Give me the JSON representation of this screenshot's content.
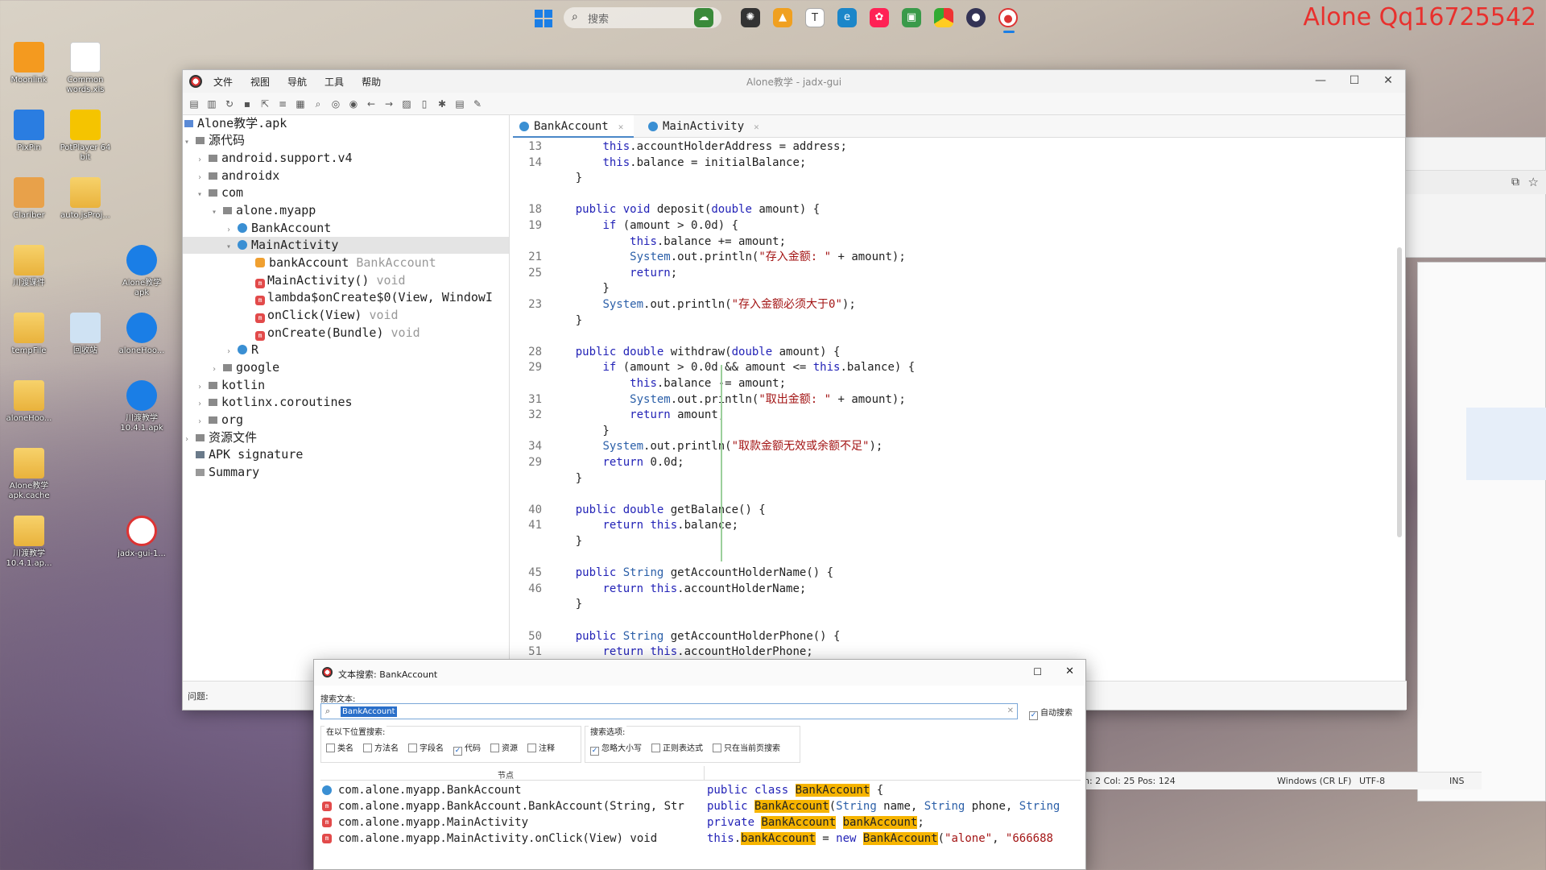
{
  "watermark": "Alone Qq16725542",
  "taskbar": {
    "search_placeholder": "搜索",
    "apps": [
      "weather-icon",
      "bug-icon",
      "firewall-icon",
      "typora-icon",
      "edge-icon",
      "paint-icon",
      "photos-icon",
      "chrome-icon",
      "mixed-app-icon",
      "jadx-taskbar-icon"
    ]
  },
  "desktop": {
    "icons": [
      {
        "label": "Moonlink",
        "kind": "app"
      },
      {
        "label": "Common words.xls",
        "kind": "file"
      },
      {
        "label": "PixPin",
        "kind": "app"
      },
      {
        "label": "PotPlayer 64 bit",
        "kind": "app"
      },
      {
        "label": "Clariber",
        "kind": "app"
      },
      {
        "label": "auto.jsProj...",
        "kind": "folder"
      },
      {
        "label": "川渡课件",
        "kind": "folder"
      },
      {
        "label": "Alone教学 apk",
        "kind": "app"
      },
      {
        "label": "tempFile",
        "kind": "folder"
      },
      {
        "label": "回收站",
        "kind": "app"
      },
      {
        "label": "aloneHoo...",
        "kind": "app"
      },
      {
        "label": "aloneHoo...",
        "kind": "folder"
      },
      {
        "label": "川渡教学 10.4.1.apk",
        "kind": "app"
      },
      {
        "label": "Alone教学 apk.cache",
        "kind": "folder"
      },
      {
        "label": "川渡教学 10.4.1.ap...",
        "kind": "folder"
      },
      {
        "label": "jadx-gui-1...",
        "kind": "app"
      }
    ]
  },
  "window": {
    "title": "Alone教学 - jadx-gui",
    "menu": [
      "文件",
      "视图",
      "导航",
      "工具",
      "帮助"
    ],
    "tree": [
      {
        "label": "Alone教学.apk",
        "icon": "apk",
        "level": 0
      },
      {
        "label": "源代码",
        "icon": "src",
        "level": 0,
        "arrow": "▾"
      },
      {
        "label": "android.support.v4",
        "icon": "pkg",
        "level": 1,
        "arrow": "›"
      },
      {
        "label": "androidx",
        "icon": "pkg",
        "level": 1,
        "arrow": "›"
      },
      {
        "label": "com",
        "icon": "pkg",
        "level": 1,
        "arrow": "▾"
      },
      {
        "label": "alone.myapp",
        "icon": "pkg",
        "level": 2,
        "arrow": "▾"
      },
      {
        "label": "BankAccount",
        "icon": "cls",
        "level": 3,
        "arrow": "›"
      },
      {
        "label": "MainActivity",
        "icon": "cls",
        "level": 3,
        "arrow": "▾",
        "selected": true
      },
      {
        "label": "bankAccount",
        "suffix": "BankAccount",
        "icon": "fld",
        "level": 4
      },
      {
        "label": "MainActivity()",
        "suffix": "void",
        "icon": "m",
        "level": 4
      },
      {
        "label": "lambda$onCreate$0(View, WindowI",
        "suffix": "",
        "icon": "m",
        "level": 4
      },
      {
        "label": "onClick(View)",
        "suffix": "void",
        "icon": "m",
        "level": 4
      },
      {
        "label": "onCreate(Bundle)",
        "suffix": "void",
        "icon": "m",
        "level": 4
      },
      {
        "label": "R",
        "icon": "cls",
        "level": 3,
        "arrow": "›"
      },
      {
        "label": "google",
        "icon": "pkg",
        "level": 2,
        "arrow": "›"
      },
      {
        "label": "kotlin",
        "icon": "pkg",
        "level": 1,
        "arrow": "›"
      },
      {
        "label": "kotlinx.coroutines",
        "icon": "pkg",
        "level": 1,
        "arrow": "›"
      },
      {
        "label": "org",
        "icon": "pkg",
        "level": 1,
        "arrow": "›"
      },
      {
        "label": "资源文件",
        "icon": "res",
        "level": 0,
        "arrow": "›"
      },
      {
        "label": "APK signature",
        "icon": "sig",
        "level": 0
      },
      {
        "label": "Summary",
        "icon": "sum",
        "level": 0
      }
    ],
    "tabs": [
      {
        "label": "BankAccount",
        "active": true
      },
      {
        "label": "MainActivity",
        "active": false
      }
    ],
    "code": [
      {
        "n": "13",
        "t": [
          [
            "",
            "        "
          ],
          [
            "kw",
            "this"
          ],
          [
            "",
            ".accountHolderAddress = address;"
          ]
        ]
      },
      {
        "n": "14",
        "t": [
          [
            "",
            "        "
          ],
          [
            "kw",
            "this"
          ],
          [
            "",
            ".balance = initialBalance;"
          ]
        ]
      },
      {
        "n": "",
        "t": [
          [
            "",
            "    }"
          ]
        ]
      },
      {
        "n": "",
        "t": []
      },
      {
        "n": "18",
        "t": [
          [
            "",
            "    "
          ],
          [
            "kw",
            "public void "
          ],
          [
            "",
            "deposit("
          ],
          [
            "kw",
            "double "
          ],
          [
            "",
            "amount) {"
          ]
        ]
      },
      {
        "n": "19",
        "t": [
          [
            "",
            "        "
          ],
          [
            "kw",
            "if "
          ],
          [
            "",
            "(amount > 0.0d) {"
          ]
        ]
      },
      {
        "n": "",
        "t": [
          [
            "",
            "            "
          ],
          [
            "kw",
            "this"
          ],
          [
            "",
            ".balance += amount;"
          ]
        ]
      },
      {
        "n": "21",
        "t": [
          [
            "",
            "            "
          ],
          [
            "typ",
            "System"
          ],
          [
            "",
            ".out.println("
          ],
          [
            "str",
            "\"存入金额: \""
          ],
          [
            "",
            " + amount);"
          ]
        ]
      },
      {
        "n": "25",
        "t": [
          [
            "",
            "            "
          ],
          [
            "kw",
            "return"
          ],
          [
            "",
            ";"
          ]
        ]
      },
      {
        "n": "",
        "t": [
          [
            "",
            "        }"
          ]
        ]
      },
      {
        "n": "23",
        "t": [
          [
            "",
            "        "
          ],
          [
            "typ",
            "System"
          ],
          [
            "",
            ".out.println("
          ],
          [
            "str",
            "\"存入金额必须大于0\""
          ],
          [
            "",
            ");"
          ]
        ]
      },
      {
        "n": "",
        "t": [
          [
            "",
            "    }"
          ]
        ]
      },
      {
        "n": "",
        "t": []
      },
      {
        "n": "28",
        "t": [
          [
            "",
            "    "
          ],
          [
            "kw",
            "public double "
          ],
          [
            "",
            "withdraw("
          ],
          [
            "kw",
            "double "
          ],
          [
            "",
            "amount) {"
          ]
        ]
      },
      {
        "n": "29",
        "t": [
          [
            "",
            "        "
          ],
          [
            "kw",
            "if "
          ],
          [
            "",
            "(amount > 0.0d && amount <= "
          ],
          [
            "kw",
            "this"
          ],
          [
            "",
            ".balance) {"
          ]
        ]
      },
      {
        "n": "",
        "t": [
          [
            "",
            "            "
          ],
          [
            "kw",
            "this"
          ],
          [
            "",
            ".balance -= amount;"
          ]
        ]
      },
      {
        "n": "31",
        "t": [
          [
            "",
            "            "
          ],
          [
            "typ",
            "System"
          ],
          [
            "",
            ".out.println("
          ],
          [
            "str",
            "\"取出金额: \""
          ],
          [
            "",
            " + amount);"
          ]
        ]
      },
      {
        "n": "32",
        "t": [
          [
            "",
            "            "
          ],
          [
            "kw",
            "return "
          ],
          [
            "",
            "amount;"
          ]
        ]
      },
      {
        "n": "",
        "t": [
          [
            "",
            "        }"
          ]
        ]
      },
      {
        "n": "34",
        "t": [
          [
            "",
            "        "
          ],
          [
            "typ",
            "System"
          ],
          [
            "",
            ".out.println("
          ],
          [
            "str",
            "\"取款金额无效或余额不足\""
          ],
          [
            "",
            ");"
          ]
        ]
      },
      {
        "n": "29",
        "t": [
          [
            "",
            "        "
          ],
          [
            "kw",
            "return "
          ],
          [
            "",
            "0.0d;"
          ]
        ]
      },
      {
        "n": "",
        "t": [
          [
            "",
            "    }"
          ]
        ]
      },
      {
        "n": "",
        "t": []
      },
      {
        "n": "40",
        "t": [
          [
            "",
            "    "
          ],
          [
            "kw",
            "public double "
          ],
          [
            "",
            "getBalance() {"
          ]
        ]
      },
      {
        "n": "41",
        "t": [
          [
            "",
            "        "
          ],
          [
            "kw",
            "return this"
          ],
          [
            "",
            ".balance;"
          ]
        ]
      },
      {
        "n": "",
        "t": [
          [
            "",
            "    }"
          ]
        ]
      },
      {
        "n": "",
        "t": []
      },
      {
        "n": "45",
        "t": [
          [
            "",
            "    "
          ],
          [
            "kw",
            "public "
          ],
          [
            "typ",
            "String "
          ],
          [
            "",
            "getAccountHolderName() {"
          ]
        ]
      },
      {
        "n": "46",
        "t": [
          [
            "",
            "        "
          ],
          [
            "kw",
            "return this"
          ],
          [
            "",
            ".accountHolderName;"
          ]
        ]
      },
      {
        "n": "",
        "t": [
          [
            "",
            "    }"
          ]
        ]
      },
      {
        "n": "",
        "t": []
      },
      {
        "n": "50",
        "t": [
          [
            "",
            "    "
          ],
          [
            "kw",
            "public "
          ],
          [
            "typ",
            "String "
          ],
          [
            "",
            "getAccountHolderPhone() {"
          ]
        ]
      },
      {
        "n": "51",
        "t": [
          [
            "",
            "        "
          ],
          [
            "kw",
            "return this"
          ],
          [
            "",
            ".accountHolderPhone;"
          ]
        ]
      }
    ],
    "status": {
      "problems": "问题:",
      "cursor": "n: 2  Col: 25  Pos: 124",
      "line_ending": "Windows (CR LF)",
      "encoding": "UTF-8",
      "mode": "INS"
    }
  },
  "search_dialog": {
    "title": "文本搜索: BankAccount",
    "search_label": "搜索文本:",
    "search_value": "BankAccount",
    "auto_search_label": "自动搜索",
    "scope_label": "在以下位置搜索:",
    "scope_options": [
      {
        "label": "类名",
        "checked": false
      },
      {
        "label": "方法名",
        "checked": false
      },
      {
        "label": "字段名",
        "checked": false
      },
      {
        "label": "代码",
        "checked": true
      },
      {
        "label": "资源",
        "checked": false
      },
      {
        "label": "注释",
        "checked": false
      }
    ],
    "options_label": "搜索选项:",
    "search_options": [
      {
        "label": "忽略大小写",
        "checked": true
      },
      {
        "label": "正则表达式",
        "checked": false
      },
      {
        "label": "只在当前页搜索",
        "checked": false
      }
    ],
    "column_node": "节点",
    "results": [
      {
        "loc": "com.alone.myapp.BankAccount",
        "icon": "cls",
        "code": [
          [
            "kw",
            "public class "
          ],
          [
            "hl",
            "BankAccount"
          ],
          [
            "",
            " {"
          ]
        ]
      },
      {
        "loc": "com.alone.myapp.BankAccount.BankAccount(String, Str",
        "icon": "m",
        "code": [
          [
            "kw",
            "public "
          ],
          [
            "hl",
            "BankAccount"
          ],
          [
            "",
            "("
          ],
          [
            "typ",
            "String"
          ],
          [
            "",
            " name, "
          ],
          [
            "typ",
            "String"
          ],
          [
            "",
            " phone, "
          ],
          [
            "typ",
            "String"
          ]
        ]
      },
      {
        "loc": "com.alone.myapp.MainActivity",
        "icon": "m",
        "code": [
          [
            "kw",
            "private "
          ],
          [
            "hl",
            "BankAccount"
          ],
          [
            "",
            " "
          ],
          [
            "hl",
            "bankAccount"
          ],
          [
            "",
            ";"
          ]
        ]
      },
      {
        "loc": "com.alone.myapp.MainActivity.onClick(View)  void",
        "icon": "m",
        "code": [
          [
            "kw",
            "this"
          ],
          [
            "",
            "."
          ],
          [
            "hl",
            "bankAccount"
          ],
          [
            "",
            " = "
          ],
          [
            "kw",
            "new "
          ],
          [
            "hl",
            "BankAccount"
          ],
          [
            "",
            "("
          ],
          [
            "str",
            "\"alone\""
          ],
          [
            "",
            ", "
          ],
          [
            "str",
            "\"666688"
          ]
        ]
      }
    ]
  }
}
